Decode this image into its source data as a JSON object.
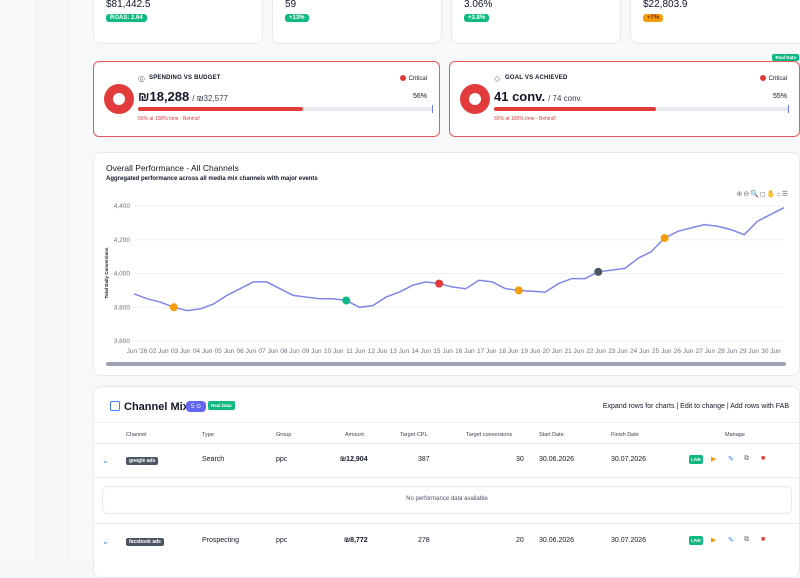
{
  "kpis": [
    {
      "value": "$81,442.5",
      "badge": "ROAS: 2.64",
      "badge_color": "green"
    },
    {
      "value": "59",
      "badge": "+13%",
      "badge_color": "green"
    },
    {
      "value": "3.06%",
      "badge": "+3.8%",
      "badge_color": "green"
    },
    {
      "value": "$22,803.9",
      "badge": "+7%",
      "badge_color": "orange"
    }
  ],
  "spending": {
    "title": "SPENDING VS BUDGET",
    "status": "Critical",
    "value": "₪18,288",
    "of": "/ ₪32,577",
    "pct_label": "56%",
    "pct": 0.56,
    "note": "56% at 100% time - Behind!"
  },
  "goal": {
    "title": "GOAL VS ACHIEVED",
    "status": "Critical",
    "value": "41 conv.",
    "of": "/ 74 conv.",
    "pct_label": "55%",
    "pct": 0.55,
    "note": "55% at 100% time - Behind!",
    "realtime_badge": "Real Data"
  },
  "chart": {
    "title": "Overall Performance - All Channels",
    "subtitle": "Aggregated performance across all media mix channels with major events",
    "toolbar": "⊕⊖🔍◻✋⌂☰",
    "ylabel": "Total Daily Conversions"
  },
  "chart_data": {
    "type": "line",
    "ylabel": "Total Daily Conversions",
    "ylim": [
      3600,
      4400
    ],
    "yticks": [
      "3,600",
      "3,800",
      "4,000",
      "4,200",
      "4,400"
    ],
    "xticks": [
      "Jun '26",
      "02 Jun",
      "03 Jun",
      "04 Jun",
      "05 Jun",
      "06 Jun",
      "07 Jun",
      "08 Jun",
      "09 Jun",
      "10 Jun",
      "11 Jun",
      "12 Jun",
      "13 Jun",
      "14 Jun",
      "15 Jun",
      "16 Jun",
      "17 Jun",
      "18 Jun",
      "19 Jun",
      "20 Jun",
      "21 Jun",
      "22 Jun",
      "23 Jun",
      "24 Jun",
      "25 Jun",
      "26 Jun",
      "27 Jun",
      "28 Jun",
      "29 Jun",
      "30 Jun"
    ],
    "series": [
      {
        "color": "#8086e6",
        "values": [
          3880,
          3850,
          3830,
          3800,
          3780,
          3790,
          3820,
          3870,
          3910,
          3950,
          3950,
          3910,
          3870,
          3860,
          3850,
          3850,
          3840,
          3800,
          3810,
          3860,
          3890,
          3930,
          3950,
          3940,
          3920,
          3910,
          3960,
          3950,
          3910,
          3900,
          3895,
          3890,
          3940,
          3970,
          3970,
          4010,
          4020,
          4030,
          4090,
          4130,
          4210,
          4250,
          4270,
          4290,
          4280,
          4260,
          4230,
          4310,
          4350,
          4390
        ]
      }
    ],
    "events": [
      {
        "index": 3,
        "color": "#f59e0b"
      },
      {
        "index": 16,
        "color": "#10b981"
      },
      {
        "index": 23,
        "color": "#e23b3b"
      },
      {
        "index": 29,
        "color": "#f59e0b"
      },
      {
        "index": 35,
        "color": "#4b5563"
      },
      {
        "index": 40,
        "color": "#f59e0b"
      }
    ]
  },
  "mix": {
    "title": "Channel Mix",
    "count": "5 ⊙",
    "realtime": "Real Data",
    "actions": "Expand rows for charts | Edit to change | Add rows with FAB",
    "headers": [
      "Channel",
      "Type",
      "Group",
      "Amount",
      "Target CPL",
      "Target conversions",
      "Start Date",
      "Finish Date",
      "Manage"
    ],
    "rows": [
      {
        "channel": "google ads",
        "type": "Search",
        "group": "ppc",
        "amount": "₪12,904",
        "cpl": "387",
        "conv": "30",
        "start": "30.06.2026",
        "finish": "30.07.2026"
      },
      {
        "channel": "facebook ads",
        "type": "Prospecting",
        "group": "ppc",
        "amount": "₪8,772",
        "cpl": "278",
        "conv": "20",
        "start": "30.06.2026",
        "finish": "30.07.2026"
      }
    ],
    "empty": "No performance data available",
    "live": "LIVE"
  }
}
